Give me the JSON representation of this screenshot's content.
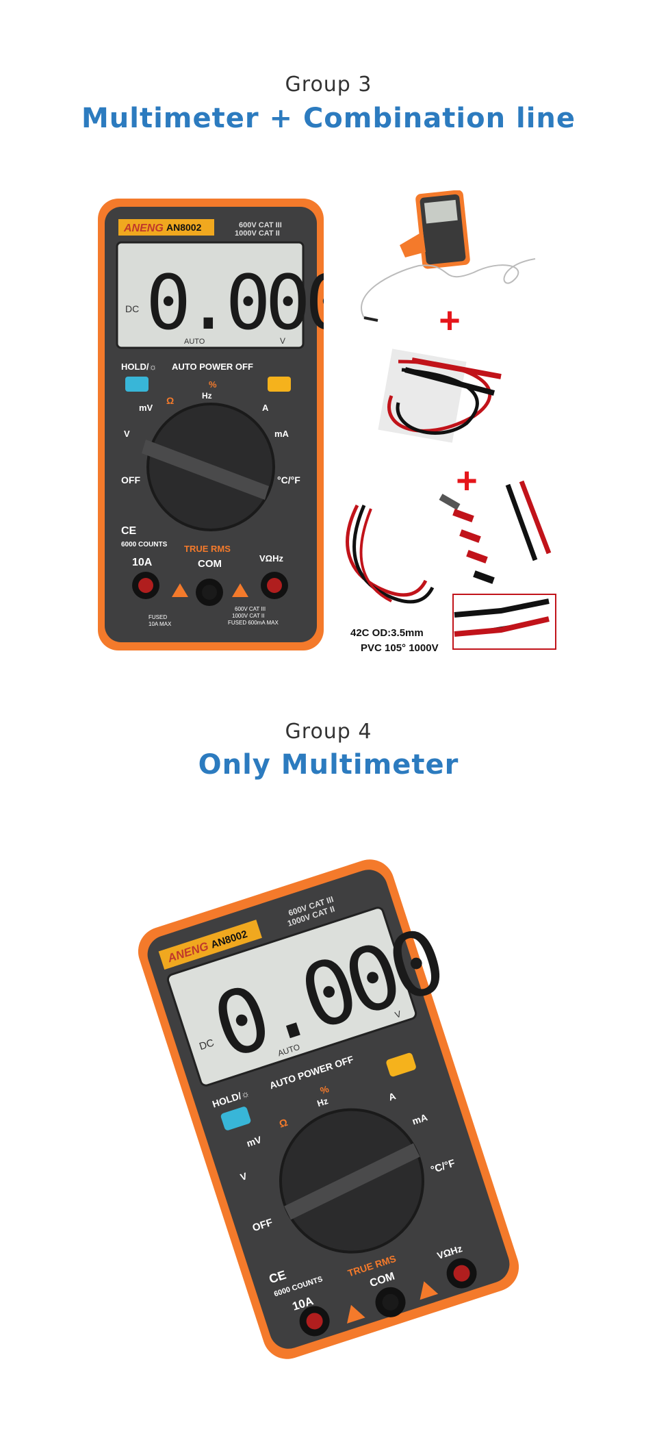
{
  "group3": {
    "title": "Group 3",
    "subtitle": "Multimeter + Combination line"
  },
  "group4": {
    "title": "Group 4",
    "subtitle": "Only Multimeter"
  },
  "meter": {
    "brand": "ANENG",
    "tm": "™",
    "model": "AN8002",
    "cat1": "600V  CAT III",
    "cat2": "1000V  CAT II",
    "reading": "0.000",
    "dc": "DC",
    "auto": "AUTO",
    "unit": "V",
    "hold": "HOLD/☼",
    "auto_power_off": "AUTO POWER OFF",
    "pct": "%",
    "hz": "Hz",
    "mv": "mV",
    "v": "V",
    "a": "A",
    "ma": "mA",
    "off": "OFF",
    "cf": "°C/°F",
    "ce": "CE",
    "counts": "6000 COUNTS",
    "true_rms": "TRUE RMS",
    "range10a": "10A",
    "com": "COM",
    "vohm": "VΩHz",
    "fused1": "FUSED",
    "fused2": "10A MAX",
    "f600": "600V  CAT III",
    "f1000": "1000V  CAT II",
    "ffused": "FUSED 600mA MAX",
    "warn": "!"
  },
  "spec": {
    "line1": "42C   OD:3.5mm",
    "line2": "PVC  105°  1000V"
  },
  "plus": "+"
}
